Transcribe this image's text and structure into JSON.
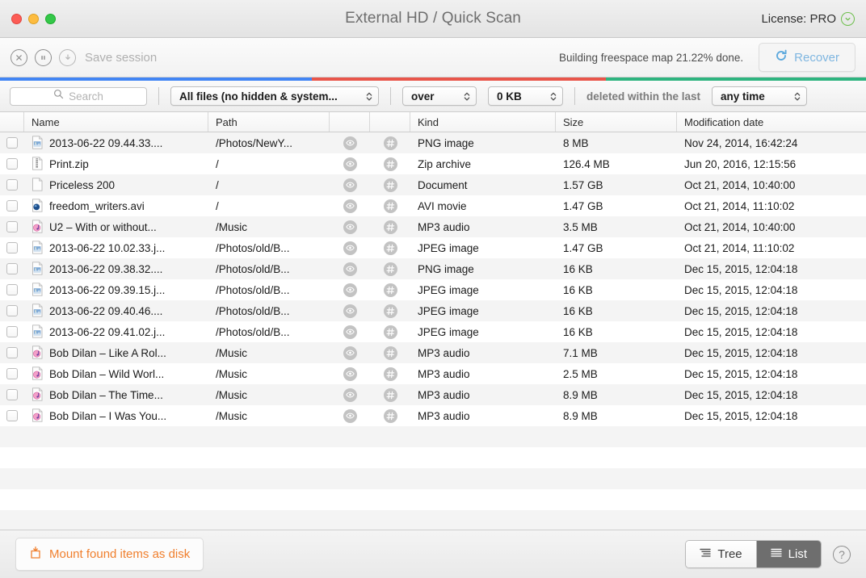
{
  "window": {
    "title": "External HD / Quick Scan",
    "license_label": "License: PRO",
    "traffic_lights": [
      "close-button",
      "minimize-button",
      "maximize-button"
    ]
  },
  "toolbar": {
    "stop_icon": "stop-circle-icon",
    "pause_icon": "pause-circle-icon",
    "download_icon": "download-circle-icon",
    "save_session_label": "Save session",
    "status": "Building freespace map 21.22% done.",
    "recover_label": "Recover",
    "recover_icon": "refresh-circle-icon"
  },
  "progress": {
    "percent": 21.22,
    "segments": [
      {
        "name": "scanned",
        "color": "#4285f4",
        "width_pct": 36
      },
      {
        "name": "processing",
        "color": "#e8554a",
        "width_pct": 34
      },
      {
        "name": "remaining",
        "color": "#2eb47f",
        "width_pct": 30
      }
    ]
  },
  "filters": {
    "search_placeholder": "Search",
    "search_value": "",
    "file_type": "All files (no hidden & system...",
    "comparator": "over",
    "size": "0 KB",
    "deleted_label": "deleted within the last",
    "time_range": "any time"
  },
  "table": {
    "columns": [
      "Name",
      "Path",
      "Kind",
      "Size",
      "Modification date"
    ],
    "headers": {
      "name": "Name",
      "path": "Path",
      "kind": "Kind",
      "size": "Size",
      "date": "Modification date"
    },
    "row_icons": {
      "preview": "eye-icon",
      "hash": "hash-icon"
    },
    "rows": [
      {
        "icon": "image-file-icon",
        "name": "2013-06-22 09.44.33....",
        "path": "/Photos/NewY...",
        "kind": "PNG image",
        "size": "8 MB",
        "date": "Nov 24, 2014, 16:42:24"
      },
      {
        "icon": "zip-file-icon",
        "name": "Print.zip",
        "path": "/",
        "kind": "Zip archive",
        "size": "126.4 MB",
        "date": "Jun 20, 2016, 12:15:56"
      },
      {
        "icon": "document-file-icon",
        "name": "Priceless 200",
        "path": "/",
        "kind": "Document",
        "size": "1.57 GB",
        "date": "Oct 21, 2014, 10:40:00"
      },
      {
        "icon": "video-file-icon",
        "name": "freedom_writers.avi",
        "path": "/",
        "kind": "AVI movie",
        "size": "1.47 GB",
        "date": "Oct 21, 2014, 11:10:02"
      },
      {
        "icon": "audio-file-icon",
        "name": "U2 – With or without...",
        "path": "/Music",
        "kind": "MP3 audio",
        "size": "3.5 MB",
        "date": "Oct 21, 2014, 10:40:00"
      },
      {
        "icon": "image-file-icon",
        "name": "2013-06-22 10.02.33.j...",
        "path": "/Photos/old/B...",
        "kind": "JPEG image",
        "size": "1.47 GB",
        "date": "Oct 21, 2014, 11:10:02"
      },
      {
        "icon": "image-file-icon",
        "name": "2013-06-22 09.38.32....",
        "path": "/Photos/old/B...",
        "kind": "PNG image",
        "size": "16 KB",
        "date": "Dec 15, 2015, 12:04:18"
      },
      {
        "icon": "image-file-icon",
        "name": "2013-06-22 09.39.15.j...",
        "path": "/Photos/old/B...",
        "kind": "JPEG image",
        "size": "16 KB",
        "date": "Dec 15, 2015, 12:04:18"
      },
      {
        "icon": "image-file-icon",
        "name": "2013-06-22 09.40.46....",
        "path": "/Photos/old/B...",
        "kind": "JPEG image",
        "size": "16 KB",
        "date": "Dec 15, 2015, 12:04:18"
      },
      {
        "icon": "image-file-icon",
        "name": "2013-06-22 09.41.02.j...",
        "path": "/Photos/old/B...",
        "kind": "JPEG image",
        "size": "16 KB",
        "date": "Dec 15, 2015, 12:04:18"
      },
      {
        "icon": "audio-file-icon",
        "name": "Bob Dilan – Like A Rol...",
        "path": "/Music",
        "kind": "MP3 audio",
        "size": "7.1 MB",
        "date": "Dec 15, 2015, 12:04:18"
      },
      {
        "icon": "audio-file-icon",
        "name": "Bob Dilan – Wild Worl...",
        "path": "/Music",
        "kind": "MP3 audio",
        "size": "2.5 MB",
        "date": "Dec 15, 2015, 12:04:18"
      },
      {
        "icon": "audio-file-icon",
        "name": "Bob Dilan – The Time...",
        "path": "/Music",
        "kind": "MP3 audio",
        "size": "8.9 MB",
        "date": "Dec 15, 2015, 12:04:18"
      },
      {
        "icon": "audio-file-icon",
        "name": "Bob Dilan – I Was You...",
        "path": "/Music",
        "kind": "MP3 audio",
        "size": "8.9 MB",
        "date": "Dec 15, 2015, 12:04:18"
      }
    ]
  },
  "bottom": {
    "mount_label": "Mount found items as disk",
    "mount_icon": "mount-disk-icon",
    "tree_label": "Tree",
    "list_label": "List",
    "active_view": "List",
    "help_label": "?"
  },
  "colors": {
    "accent_orange": "#f07f2d",
    "accent_blue": "#7fb6e0",
    "license_green": "#6cbf4b"
  }
}
